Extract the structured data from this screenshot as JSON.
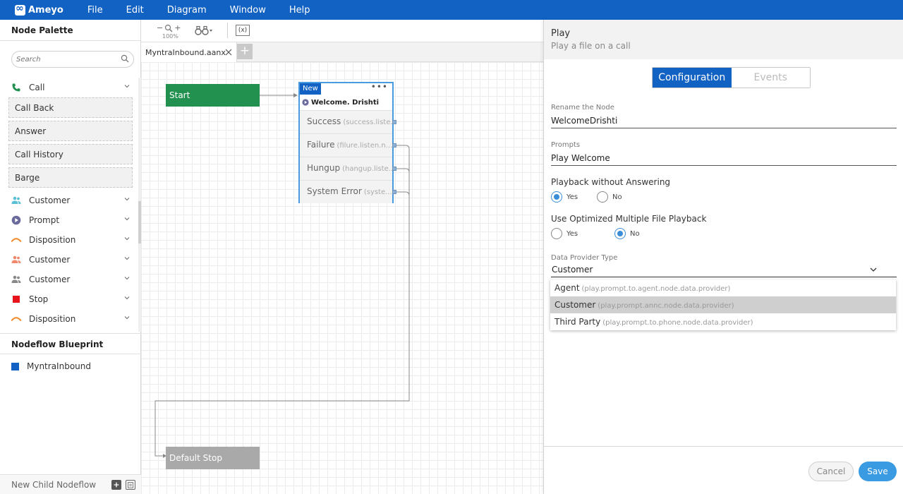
{
  "colors": {
    "brand": "#1262c4",
    "start_node": "#229150",
    "stop_node": "#a9a9a9",
    "accent": "#3a9ae2"
  },
  "menubar": {
    "app_name": "Ameyo",
    "items": [
      "File",
      "Edit",
      "Diagram",
      "Window",
      "Help"
    ]
  },
  "palette": {
    "title": "Node Palette",
    "search_placeholder": "Search",
    "categories": [
      {
        "label": "Call",
        "icon": "phone-icon"
      },
      {
        "label": "Customer",
        "icon": "users-icon"
      },
      {
        "label": "Prompt",
        "icon": "play-circle-icon"
      },
      {
        "label": "Disposition",
        "icon": "hangup-icon"
      },
      {
        "label": "Customer",
        "icon": "users-icon"
      },
      {
        "label": "Customer",
        "icon": "users-icon"
      },
      {
        "label": "Stop",
        "icon": "stop-icon"
      },
      {
        "label": "Disposition",
        "icon": "hangup-icon"
      }
    ],
    "call_subitems": [
      "Call Back",
      "Answer",
      "Call History",
      "Barge"
    ]
  },
  "blueprint": {
    "title": "Nodeflow Blueprint",
    "item": "MyntraInbound",
    "new_child": "New Child Nodeflow"
  },
  "toolbar": {
    "zoom_level": "100%",
    "variables_label": "(x)"
  },
  "tabs": {
    "file": "MyntraInbound.aanx"
  },
  "canvas": {
    "start_label": "Start",
    "stop_label": "Default Stop",
    "play_node": {
      "tag": "New",
      "title": "Welcome. Drishti",
      "ports": [
        {
          "label": "Success",
          "sub": "(success.liste...)"
        },
        {
          "label": "Failure",
          "sub": "(filure.listen.n...)"
        },
        {
          "label": "Hungup",
          "sub": "(hangup.liste...)"
        },
        {
          "label": "System Error",
          "sub": "(syste...)"
        }
      ]
    }
  },
  "props": {
    "title": "Play",
    "subtitle": "Play a file on a call",
    "tabs": {
      "configuration": "Configuration",
      "events": "Events"
    },
    "rename": {
      "label": "Rename the Node",
      "value": "WelcomeDrishti"
    },
    "prompts": {
      "label": "Prompts",
      "value": "Play Welcome"
    },
    "playback": {
      "label": "Playback without Answering",
      "yes": "Yes",
      "no": "No",
      "selected": "Yes"
    },
    "optimized": {
      "label": "Use Optimized Multiple File Playback",
      "yes": "Yes",
      "no": "No",
      "selected": "No"
    },
    "data_provider": {
      "label": "Data Provider Type",
      "value": "Customer",
      "options": [
        {
          "label": "Agent",
          "hint": "(play.prompt.to.agent.node.data.provider)"
        },
        {
          "label": "Customer",
          "hint": "(play.prompt.annc.node.data.provider)"
        },
        {
          "label": "Third Party",
          "hint": "(play.prompt.to.phone.node.data.provider)"
        }
      ]
    },
    "cancel": "Cancel",
    "save": "Save"
  }
}
